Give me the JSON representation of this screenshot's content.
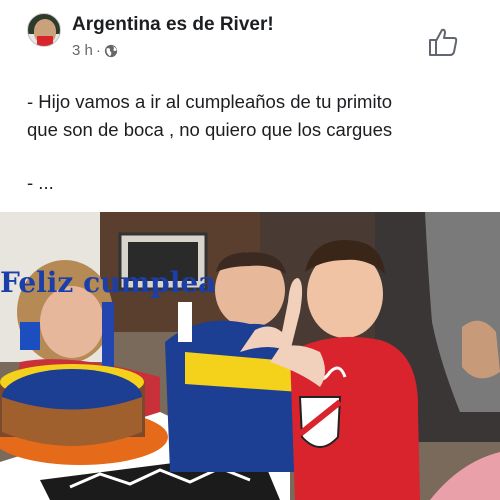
{
  "post": {
    "page_name": "Argentina es de River!",
    "time": "3 h",
    "separator": "·",
    "privacy_icon": "globe-icon",
    "like_icon": "thumbs-up-icon",
    "text_line_1": "- Hijo vamos a ir al cumpleaños de tu primito",
    "text_line_2": "que son de boca , no quiero que los cargues",
    "text_line_3": "- ...",
    "image": {
      "description_icon": "photo",
      "cake_topper_text": "Feliz cumpleaños"
    }
  },
  "colors": {
    "text": "#1c1e21",
    "meta": "#65676b",
    "river_red": "#d9232d",
    "boca_blue": "#1c3f94",
    "boca_yellow": "#f4d21b"
  }
}
